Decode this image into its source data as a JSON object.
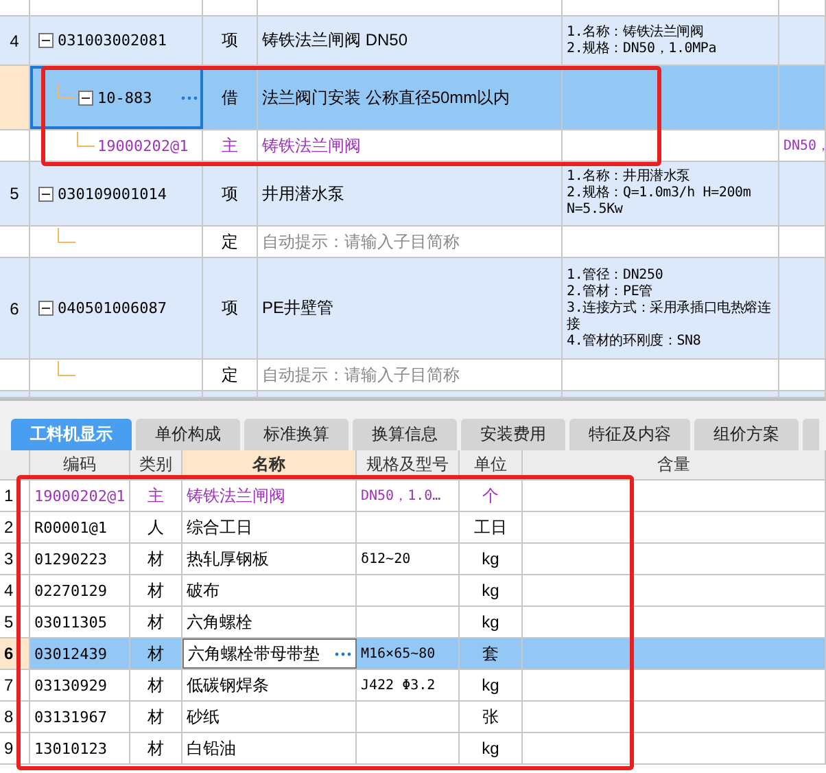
{
  "upper_table": {
    "rows": [
      {
        "number": "4",
        "code": "031003002081",
        "type": "项",
        "kind": "item",
        "name": "铸铁法兰闸阀 DN50",
        "features": [
          "1.名称：铸铁法兰闸阀",
          "2.规格：DN50，1.0MPa"
        ],
        "expanded": true,
        "selected": false,
        "children": [
          {
            "code": "10-883",
            "type": "借",
            "kind": "quota",
            "name": "法兰阀门安装 公称直径50mm以内",
            "expanded": true,
            "selected": true,
            "children": [
              {
                "code": "19000202@1",
                "type": "主",
                "kind": "main-material",
                "name": "铸铁法兰闸阀",
                "spec": "DN50，",
                "selected": false
              }
            ]
          }
        ]
      },
      {
        "number": "5",
        "code": "030109001014",
        "type": "项",
        "kind": "item",
        "name": "井用潜水泵",
        "features": [
          "1.名称：井用潜水泵",
          "2.规格：Q=1.0m3/h H=200m",
          "N=5.5Kw"
        ],
        "expanded": true,
        "selected": false,
        "children": [
          {
            "type": "定",
            "kind": "quota",
            "placeholder": "自动提示：请输入子目简称",
            "selected": false
          }
        ]
      },
      {
        "number": "6",
        "code": "040501006087",
        "type": "项",
        "kind": "item",
        "name": "PE井壁管",
        "features": [
          "1.管径：DN250",
          "2.管材：PE管",
          "3.连接方式：采用承插口电热熔连接",
          "4.管材的环刚度：SN8"
        ],
        "expanded": true,
        "selected": false,
        "children": [
          {
            "type": "定",
            "kind": "quota",
            "placeholder": "自动提示：请输入子目简称",
            "selected": false
          }
        ]
      }
    ]
  },
  "tabs": [
    {
      "label": "工料机显示",
      "selected": true
    },
    {
      "label": "单价构成",
      "selected": false
    },
    {
      "label": "标准换算",
      "selected": false
    },
    {
      "label": "换算信息",
      "selected": false
    },
    {
      "label": "安装费用",
      "selected": false
    },
    {
      "label": "特征及内容",
      "selected": false
    },
    {
      "label": "组价方案",
      "selected": false
    }
  ],
  "resource_table": {
    "columns": [
      {
        "label": "编码",
        "selected": false
      },
      {
        "label": "类别",
        "selected": false
      },
      {
        "label": "名称",
        "selected": true
      },
      {
        "label": "规格及型号",
        "selected": false
      },
      {
        "label": "单位",
        "selected": false
      },
      {
        "label": "含量",
        "selected": false
      }
    ],
    "rows": [
      {
        "number": "1",
        "code": "19000202@1",
        "type": "主",
        "kind": "main-material",
        "name": "铸铁法兰闸阀",
        "spec": "DN50，1.0…",
        "unit": "个",
        "selected": false
      },
      {
        "number": "2",
        "code": "R00001@1",
        "type": "人",
        "kind": "labor",
        "name": "综合工日",
        "unit": "工日",
        "selected": false
      },
      {
        "number": "3",
        "code": "01290223",
        "type": "材",
        "kind": "material",
        "name": "热轧厚钢板",
        "spec": "δ12~20",
        "unit": "kg",
        "selected": false
      },
      {
        "number": "4",
        "code": "02270129",
        "type": "材",
        "kind": "material",
        "name": "破布",
        "unit": "kg",
        "selected": false
      },
      {
        "number": "5",
        "code": "03011305",
        "type": "材",
        "kind": "material",
        "name": "六角螺栓",
        "unit": "kg",
        "selected": false
      },
      {
        "number": "6",
        "code": "03012439",
        "type": "材",
        "kind": "material",
        "name": "六角螺栓带母带垫",
        "spec": "M16×65~80",
        "unit": "套",
        "selected": true
      },
      {
        "number": "7",
        "code": "03130929",
        "type": "材",
        "kind": "material",
        "name": "低碳钢焊条",
        "spec": "J422 Φ3.2",
        "unit": "kg",
        "selected": false
      },
      {
        "number": "8",
        "code": "03131967",
        "type": "材",
        "kind": "material",
        "name": "砂纸",
        "unit": "张",
        "selected": false
      },
      {
        "number": "9",
        "code": "13010123",
        "type": "材",
        "kind": "material",
        "name": "白铅油",
        "unit": "kg",
        "selected": false
      }
    ]
  }
}
